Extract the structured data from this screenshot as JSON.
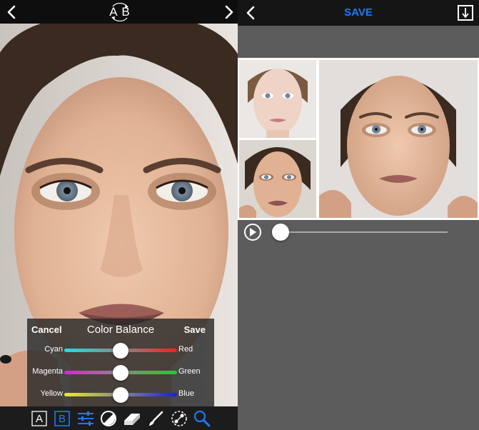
{
  "left_panel": {
    "ab_label": "A B",
    "color_balance": {
      "cancel_label": "Cancel",
      "title": "Color Balance",
      "save_label": "Save",
      "sliders": [
        {
          "left_label": "Cyan",
          "right_label": "Red",
          "value": 0.5,
          "left_color": "#19e3e3",
          "right_color": "#ff1a1a"
        },
        {
          "left_label": "Magenta",
          "right_label": "Green",
          "value": 0.5,
          "left_color": "#e81ae8",
          "right_color": "#19d419"
        },
        {
          "left_label": "Yellow",
          "right_label": "Blue",
          "value": 0.5,
          "left_color": "#ecec19",
          "right_color": "#1a1aee"
        }
      ]
    },
    "toolbar": {
      "a_label": "A",
      "b_label": "B",
      "icons": [
        "a-layer-icon",
        "b-layer-icon",
        "adjust-sliders-icon",
        "contrast-icon",
        "eraser-icon",
        "brush-icon",
        "transform-icon",
        "zoom-icon"
      ]
    }
  },
  "right_panel": {
    "save_label": "SAVE",
    "playback_progress": 0.05
  },
  "colors": {
    "accent": "#1a7cf5",
    "panel_bg": "#5c5c5c",
    "topbar_bg": "#151515"
  }
}
